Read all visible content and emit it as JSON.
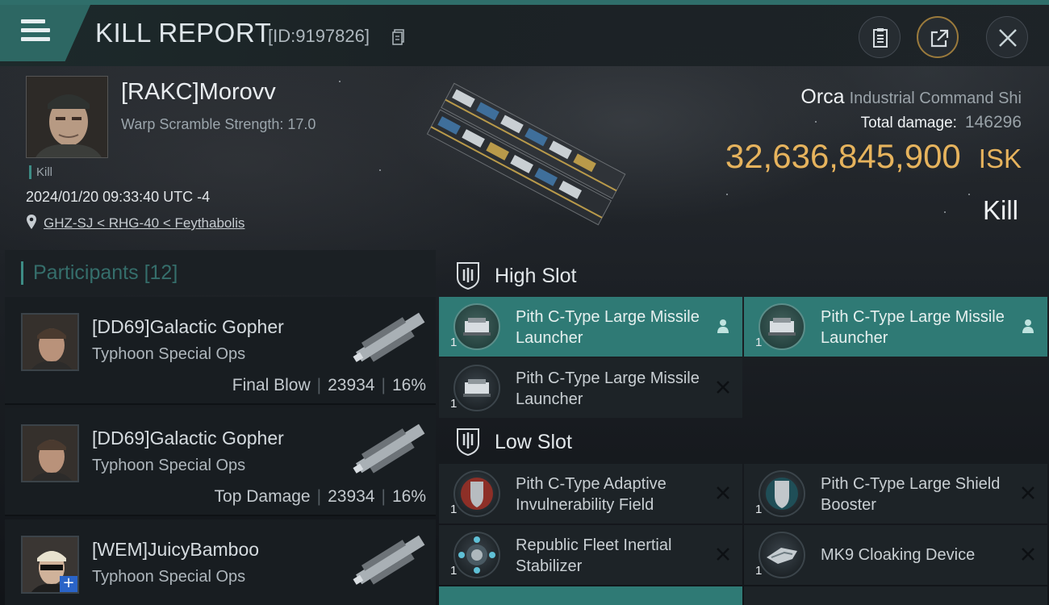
{
  "header": {
    "title": "KILL REPORT",
    "report_id": "[ID:9197826]"
  },
  "victim": {
    "name": "[RAKC]Morovv",
    "warp_scramble": "Warp Scramble Strength: 17.0",
    "kill_tag": "Kill",
    "timestamp": "2024/01/20 09:33:40 UTC -4",
    "location": "GHZ-SJ < RHG-40 < Feythabolis",
    "ship_name": "Orca",
    "ship_class": "Industrial Command Shi",
    "total_damage_label": "Total damage:",
    "total_damage_value": "146296",
    "isk_value": "32,636,845,900",
    "isk_unit": "ISK",
    "result": "Kill"
  },
  "participants": {
    "title": "Participants",
    "count": "[12]",
    "rows": [
      {
        "name": "[DD69]Galactic Gopher",
        "ship": "Typhoon Special Ops",
        "tag": "Final Blow",
        "damage": "23934",
        "percent": "16%"
      },
      {
        "name": "[DD69]Galactic Gopher",
        "ship": "Typhoon Special Ops",
        "tag": "Top Damage",
        "damage": "23934",
        "percent": "16%"
      },
      {
        "name": "[WEM]JuicyBamboo",
        "ship": "Typhoon Special Ops",
        "tag": "",
        "damage": "",
        "percent": ""
      }
    ]
  },
  "fitting": {
    "high_slot": {
      "title": "High Slot",
      "modules": [
        {
          "name": "Pith C-Type Large Missile Launcher",
          "qty": "1",
          "state": "active",
          "icon": "missile-launcher-icon"
        },
        {
          "name": "Pith C-Type Large Missile Launcher",
          "qty": "1",
          "state": "active",
          "icon": "missile-launcher-icon"
        },
        {
          "name": "Pith C-Type Large Missile Launcher",
          "qty": "1",
          "state": "destroyed",
          "icon": "missile-launcher-icon"
        }
      ]
    },
    "low_slot": {
      "title": "Low Slot",
      "modules": [
        {
          "name": "Pith C-Type Adaptive Invulnerability Field",
          "qty": "1",
          "state": "destroyed",
          "icon": "invulnerability-field-icon"
        },
        {
          "name": "Pith C-Type Large Shield Booster",
          "qty": "1",
          "state": "destroyed",
          "icon": "shield-booster-icon"
        },
        {
          "name": "Republic Fleet Inertial Stabilizer",
          "qty": "1",
          "state": "destroyed",
          "icon": "inertial-stabilizer-icon"
        },
        {
          "name": "MK9 Cloaking Device",
          "qty": "1",
          "state": "destroyed",
          "icon": "cloaking-device-icon"
        }
      ]
    }
  },
  "colors": {
    "accent": "#2f7a75",
    "isk": "#e6b35d",
    "header_teal": "#2d6763"
  }
}
